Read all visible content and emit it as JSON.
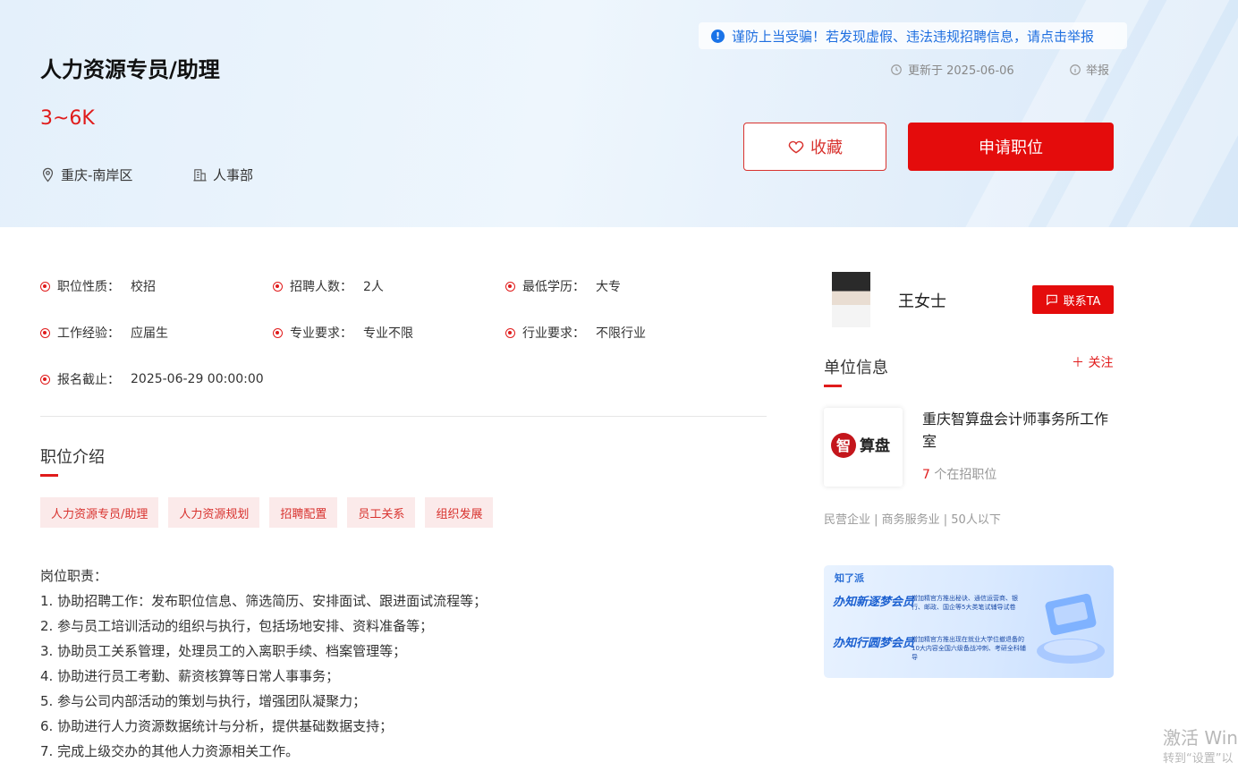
{
  "job": {
    "title": "人力资源专员/助理",
    "salary": "3~6K",
    "location": "重庆-南岸区",
    "department": "人事部"
  },
  "notice": {
    "warning": "谨防上当受骗！若发现虚假、违法违规招聘信息，请点击举报",
    "updated": "更新于 2025-06-06",
    "report": "举报"
  },
  "actions": {
    "favorite": "收藏",
    "apply": "申请职位"
  },
  "attributes": [
    {
      "label": "职位性质：",
      "value": "校招"
    },
    {
      "label": "招聘人数：",
      "value": "2人"
    },
    {
      "label": "最低学历：",
      "value": "大专"
    },
    {
      "label": "工作经验：",
      "value": "应届生"
    },
    {
      "label": "专业要求：",
      "value": "专业不限"
    },
    {
      "label": "行业要求：",
      "value": "不限行业"
    },
    {
      "label": "报名截止：",
      "value": "2025-06-29 00:00:00"
    }
  ],
  "intro": {
    "title": "职位介绍",
    "tags": [
      "人力资源专员/助理",
      "人力资源规划",
      "招聘配置",
      "员工关系",
      "组织发展"
    ],
    "lines": [
      "岗位职责：",
      "1. 协助招聘工作：发布职位信息、筛选简历、安排面试、跟进面试流程等；",
      "2. 参与员工培训活动的组织与执行，包括场地安排、资料准备等；",
      "3. 协助员工关系管理，处理员工的入离职手续、档案管理等；",
      "4. 协助进行员工考勤、薪资核算等日常人事事务；",
      "5. 参与公司内部活动的策划与执行，增强团队凝聚力；",
      "6. 协助进行人力资源数据统计与分析，提供基础数据支持；",
      "7. 完成上级交办的其他人力资源相关工作。"
    ]
  },
  "recruiter": {
    "name": "王女士",
    "contact": "联系TA"
  },
  "company": {
    "section_title": "单位信息",
    "follow": "关注",
    "name": "重庆智算盘会计师事务所工作室",
    "logo_text": "智算盘",
    "positions_count": "7",
    "positions_suffix": " 个在招职位",
    "tags": "民营企业 | 商务服务业 | 50人以下"
  },
  "banner": {
    "brand": "知了派",
    "line1": "办知新逐梦会员",
    "line2": "办知行圆梦会员",
    "text1": "增加精官方推出秘诀、通信运营商、银行、邮政、国企等5大类笔试辅导试卷",
    "text2": "增加精官方推出现在就业大学位撤退备的10大内容全国六级备战冲刺、考研全科辅导"
  },
  "watermark": {
    "line1": "激活 Win",
    "line2": "转到“设置”以"
  },
  "colors": {
    "accent": "#e40c0c",
    "info": "#1a73e8"
  }
}
